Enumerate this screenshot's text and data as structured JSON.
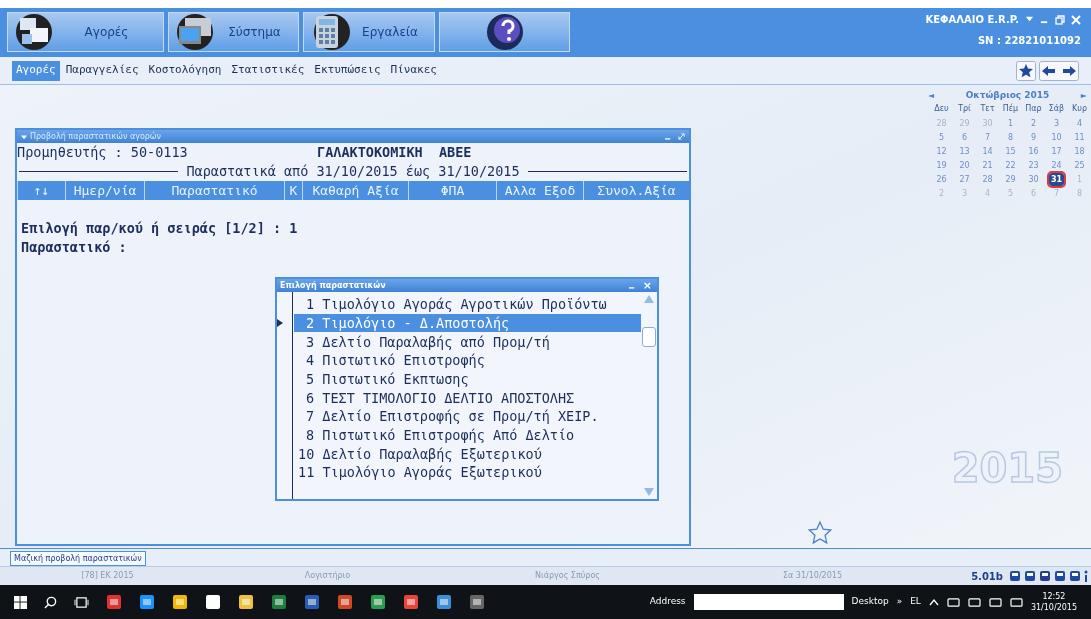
{
  "toolbar": {
    "buttons": [
      {
        "label": "Αγορές",
        "kind": "cards"
      },
      {
        "label": "Σύστημα",
        "kind": "monitor"
      },
      {
        "label": "Εργαλεία",
        "kind": "calculator"
      },
      {
        "kind": "help"
      }
    ],
    "product": "ΚΕΦΑΛΑΙΟ E.R.P.",
    "serial": "SN : 22821011092"
  },
  "menu": {
    "items": [
      {
        "label": "Αγορές",
        "selected": true
      },
      {
        "label": "Παραγγελίες",
        "selected": false
      },
      {
        "label": "Κοστολόγηση",
        "selected": false
      },
      {
        "label": "Στατιστικές",
        "selected": false
      },
      {
        "label": "Εκτυπώσεις",
        "selected": false
      },
      {
        "label": "Πίνακες",
        "selected": false
      }
    ]
  },
  "calendar": {
    "prev": "◄",
    "month": "Οκτώβριος 2015",
    "next": "►",
    "weekdays": [
      "Δευ",
      "Τρί",
      "Τετ",
      "Πέμ",
      "Παρ",
      "Σάβ",
      "Κυρ"
    ],
    "weeks": [
      [
        {
          "d": "28",
          "muted": true,
          "selected": false
        },
        {
          "d": "29",
          "muted": true,
          "selected": false
        },
        {
          "d": "30",
          "muted": true,
          "selected": false
        },
        {
          "d": "1",
          "muted": false,
          "selected": false
        },
        {
          "d": "2",
          "muted": false,
          "selected": false
        },
        {
          "d": "3",
          "muted": false,
          "selected": false
        },
        {
          "d": "4",
          "muted": false,
          "selected": false
        }
      ],
      [
        {
          "d": "5",
          "muted": false,
          "selected": false
        },
        {
          "d": "6",
          "muted": false,
          "selected": false
        },
        {
          "d": "7",
          "muted": false,
          "selected": false
        },
        {
          "d": "8",
          "muted": false,
          "selected": false
        },
        {
          "d": "9",
          "muted": false,
          "selected": false
        },
        {
          "d": "10",
          "muted": false,
          "selected": false
        },
        {
          "d": "11",
          "muted": false,
          "selected": false
        }
      ],
      [
        {
          "d": "12",
          "muted": false,
          "selected": false
        },
        {
          "d": "13",
          "muted": false,
          "selected": false
        },
        {
          "d": "14",
          "muted": false,
          "selected": false
        },
        {
          "d": "15",
          "muted": false,
          "selected": false
        },
        {
          "d": "16",
          "muted": false,
          "selected": false
        },
        {
          "d": "17",
          "muted": false,
          "selected": false
        },
        {
          "d": "18",
          "muted": false,
          "selected": false
        }
      ],
      [
        {
          "d": "19",
          "muted": false,
          "selected": false
        },
        {
          "d": "20",
          "muted": false,
          "selected": false
        },
        {
          "d": "21",
          "muted": false,
          "selected": false
        },
        {
          "d": "22",
          "muted": false,
          "selected": false
        },
        {
          "d": "23",
          "muted": false,
          "selected": false
        },
        {
          "d": "24",
          "muted": false,
          "selected": false
        },
        {
          "d": "25",
          "muted": false,
          "selected": false
        }
      ],
      [
        {
          "d": "26",
          "muted": false,
          "selected": false
        },
        {
          "d": "27",
          "muted": false,
          "selected": false
        },
        {
          "d": "28",
          "muted": false,
          "selected": false
        },
        {
          "d": "29",
          "muted": false,
          "selected": false
        },
        {
          "d": "30",
          "muted": false,
          "selected": false
        },
        {
          "d": "31",
          "muted": false,
          "selected": true
        },
        {
          "d": "1",
          "muted": true,
          "selected": false
        }
      ],
      [
        {
          "d": "2",
          "muted": true,
          "selected": false
        },
        {
          "d": "3",
          "muted": true,
          "selected": false
        },
        {
          "d": "4",
          "muted": true,
          "selected": false
        },
        {
          "d": "5",
          "muted": true,
          "selected": false
        },
        {
          "d": "6",
          "muted": true,
          "selected": false
        },
        {
          "d": "7",
          "muted": true,
          "selected": false
        },
        {
          "d": "8",
          "muted": true,
          "selected": false
        }
      ]
    ]
  },
  "year_mark": "2015",
  "window": {
    "title": "Προβολή παραστατικών αγορών",
    "supplier_label": "Προμηθευτής : 50-0113",
    "supplier_name": "ΓΑΛΑΚΤΟΚΟΜΙΚΗ  ΑΒΕΕ",
    "period": "Παραστατικά από 31/10/2015 έως 31/10/2015",
    "columns": [
      "↑↓",
      "Ημερ/νία",
      "Παραστατικό",
      "Κ",
      "Καθαρή Αξία",
      "ΦΠΑ",
      "Αλλα Εξοδ",
      "Συνολ.Αξία"
    ],
    "lines": [
      "Επιλογή παρ/κού ή σειράς [1/2] : 1",
      "Παραστατικό :"
    ]
  },
  "picker": {
    "title": "Επιλογή παραστατικών",
    "close": "×",
    "items": [
      {
        "label": "1 Τιμολόγιο Αγοράς Αγροτικών Προϊόντω",
        "selected": false
      },
      {
        "label": "2 Τιμολόγιο - Δ.Αποστολής",
        "selected": true
      },
      {
        "label": "3 Δελτίο Παραλαβής από Προμ/τή",
        "selected": false
      },
      {
        "label": "4 Πιστωτικό Επιστροφής",
        "selected": false
      },
      {
        "label": "5 Πιστωτικό Εκπτωσης",
        "selected": false
      },
      {
        "label": "6 ΤΕΣΤ ΤΙΜΟΛΟΓΙΟ ΔΕΛΤΙΟ ΑΠΟΣΤΟΛΗΣ",
        "selected": false
      },
      {
        "label": "7 Δελτίο Επιστροφής σε Προμ/τή ΧΕΙΡ.",
        "selected": false
      },
      {
        "label": "8 Πιστωτικό Επιστροφής Από Δελτίο",
        "selected": false
      },
      {
        "label": "10 Δελτίο Παραλαβής Εξωτερικού",
        "selected": false
      },
      {
        "label": "11 Τιμολόγιο Αγοράς Εξωτερικού",
        "selected": false
      }
    ]
  },
  "bottom_tab": "Μαζική προβολή παραστατικών",
  "status_bar": {
    "cells": [
      "[78] ΕΚ 2015",
      "Λογιστήριο",
      "Νιάργος Σπύρος",
      "Σα 31/10/2015"
    ],
    "version": "5.01b"
  },
  "taskbar": {
    "address_label": "Address",
    "desktop": "Desktop",
    "chevron": "»",
    "language": "EL",
    "time": "12:52",
    "date": "31/10/2015"
  }
}
